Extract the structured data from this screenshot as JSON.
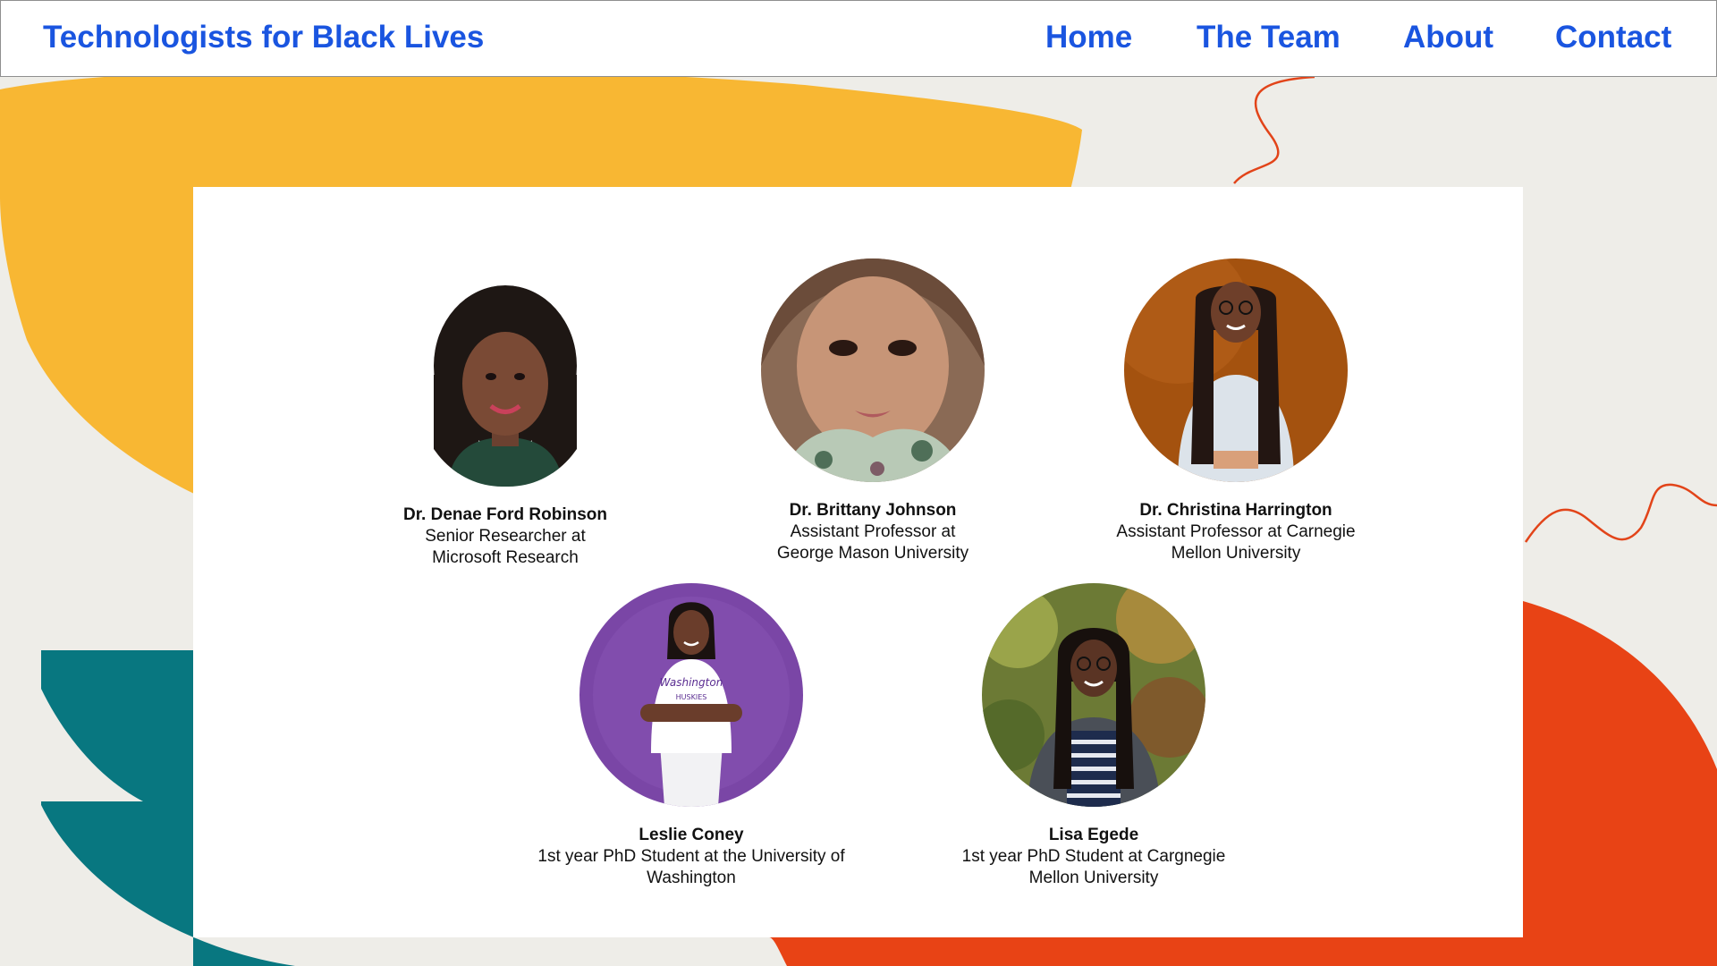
{
  "site": {
    "title": "Technologists for Black Lives"
  },
  "nav": {
    "items": [
      {
        "label": "Home"
      },
      {
        "label": "The Team"
      },
      {
        "label": "About"
      },
      {
        "label": "Contact"
      }
    ]
  },
  "theme": {
    "link_color": "#1a55e0",
    "background": "#eeede8",
    "shape_yellow": "#f8b733",
    "shape_teal": "#087780",
    "shape_orange": "#e84315"
  },
  "team": {
    "members": [
      {
        "name": "Dr. Denae Ford Robinson",
        "role_line1": "Senior Researcher at",
        "role_line2": "Microsoft Research",
        "photo_bg": "#ffffff"
      },
      {
        "name": "Dr. Brittany Johnson",
        "role_line1": "Assistant Professor at",
        "role_line2": "George Mason University",
        "photo_bg": "#8a6a55"
      },
      {
        "name": "Dr. Christina Harrington",
        "role_line1": "Assistant Professor at Carnegie",
        "role_line2": "Mellon University",
        "photo_bg": "#a4520f"
      },
      {
        "name": "Leslie Coney",
        "role_line1": "1st year PhD Student at the University of",
        "role_line2": "Washington",
        "photo_bg": "#7a46a6"
      },
      {
        "name": "Lisa Egede",
        "role_line1": "1st year PhD Student at Cargnegie",
        "role_line2": "Mellon University",
        "photo_bg": "#6c7a35"
      }
    ]
  }
}
